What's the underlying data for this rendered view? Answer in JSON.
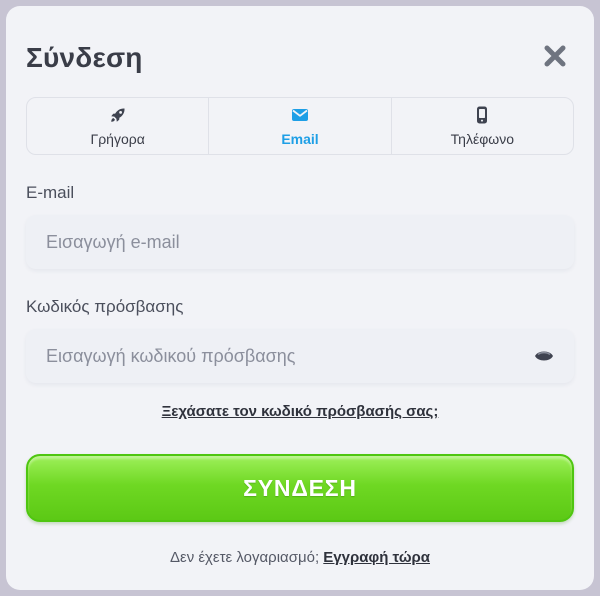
{
  "modal": {
    "title": "Σύνδεση",
    "close_icon": "close-icon"
  },
  "tabs": [
    {
      "label": "Γρήγορα",
      "icon": "rocket-icon",
      "active": false
    },
    {
      "label": "Email",
      "icon": "envelope-icon",
      "active": true
    },
    {
      "label": "Τηλέφωνο",
      "icon": "phone-icon",
      "active": false
    }
  ],
  "email_field": {
    "label": "E-mail",
    "value": "",
    "placeholder": "Εισαγωγή e-mail"
  },
  "password_field": {
    "label": "Κωδικός πρόσβασης",
    "value": "",
    "placeholder": "Εισαγωγή κωδικού πρόσβασης",
    "toggle_icon": "eye-icon"
  },
  "forgot_link": "Ξεχάσατε τον κωδικό πρόσβασής σας;",
  "login_button": "ΣΥΝΔΕΣΗ",
  "footer": {
    "text": "Δεν έχετε λογαριασμό;",
    "signup_link": "Εγγραφή τώρα"
  },
  "colors": {
    "accent": "#1e9fe6",
    "button_green": "#6fd823",
    "text_dark": "#3a3d48",
    "background": "#f2f3f7"
  }
}
